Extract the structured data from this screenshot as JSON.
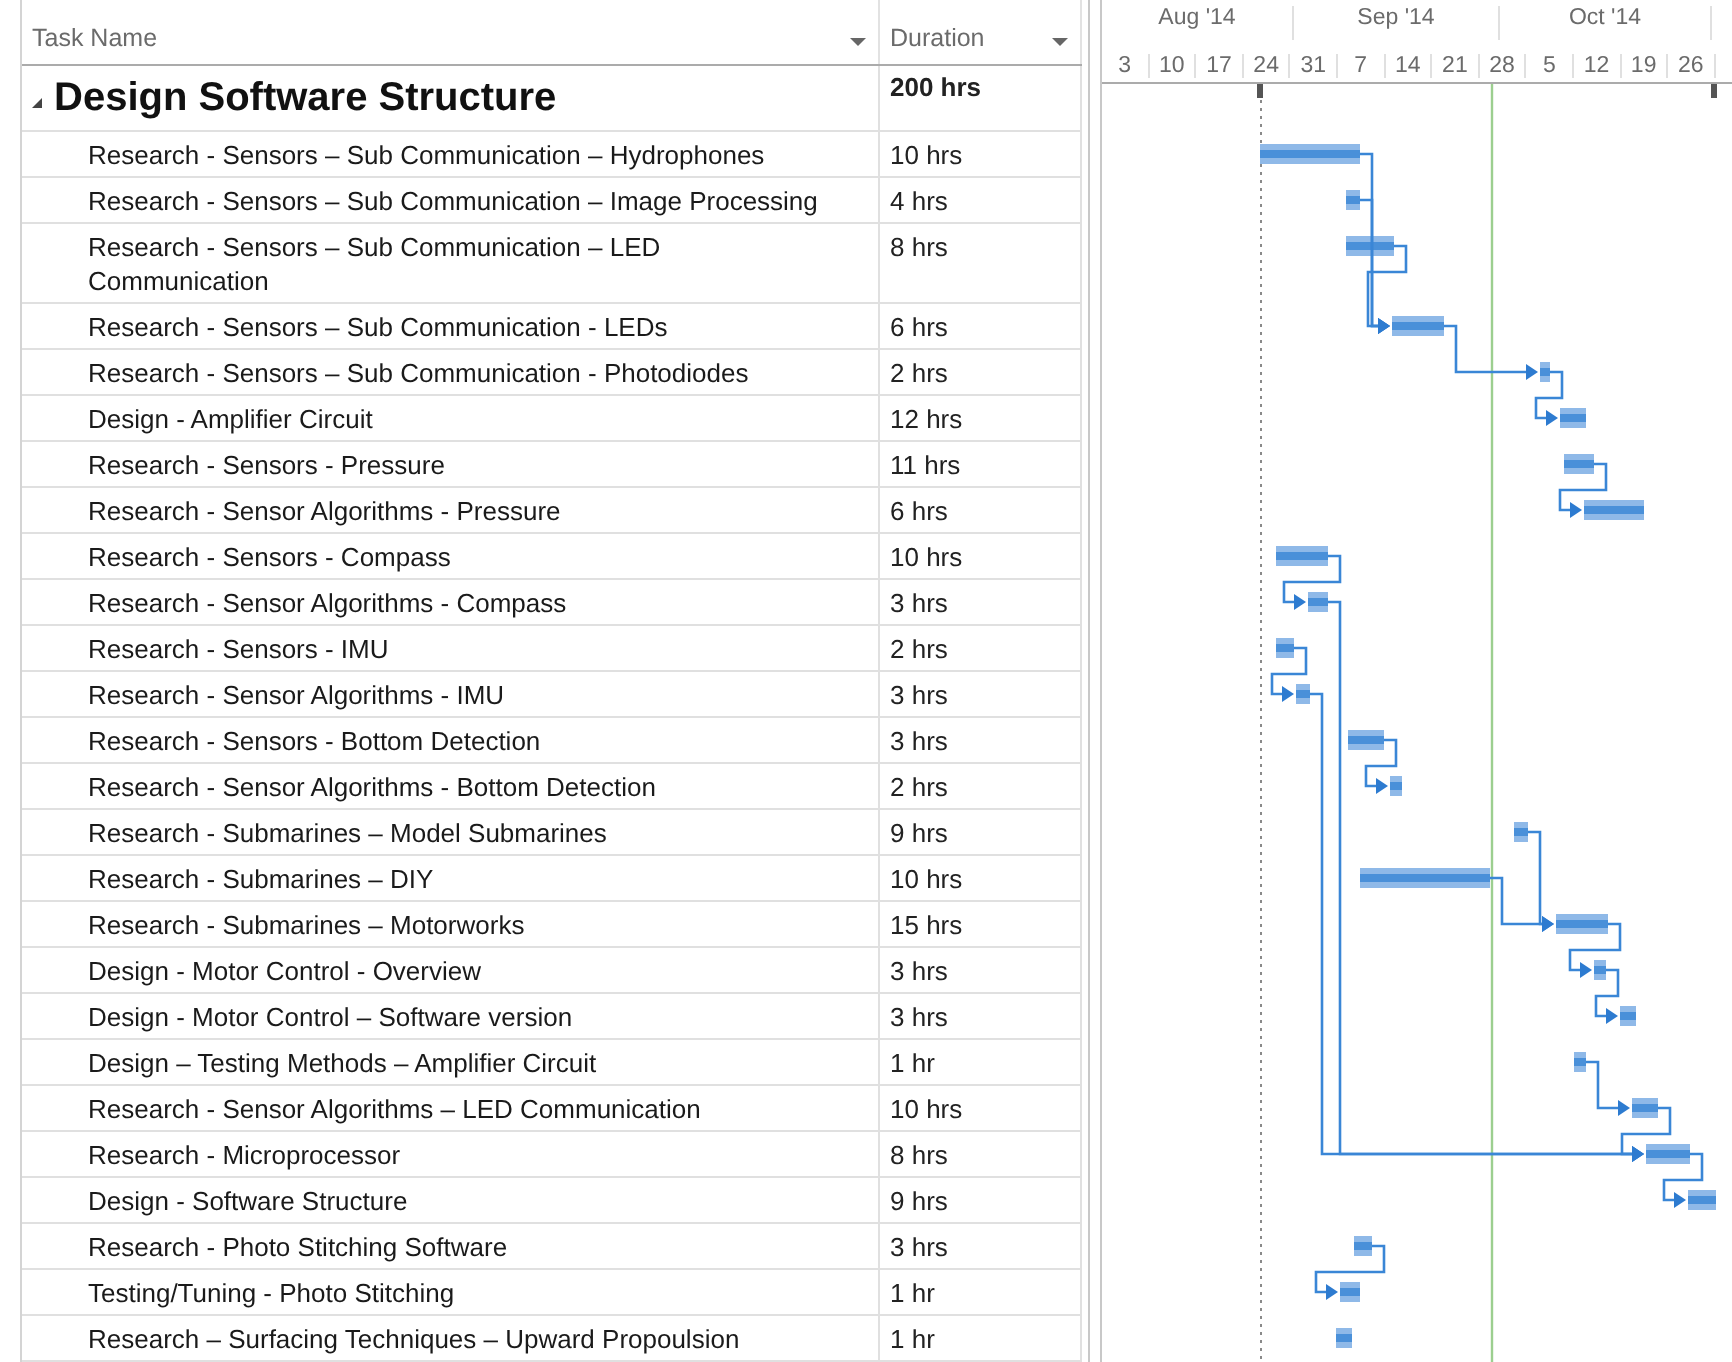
{
  "columns": [
    {
      "label": "Task Name"
    },
    {
      "label": "Duration"
    }
  ],
  "timescale": {
    "months": [
      {
        "label": "Aug '14"
      },
      {
        "label": "Sep '14"
      },
      {
        "label": "Oct '14"
      }
    ],
    "weeks": [
      "3",
      "10",
      "17",
      "24",
      "31",
      "7",
      "14",
      "21",
      "28",
      "5",
      "12",
      "19",
      "26"
    ]
  },
  "summary": {
    "name": "Design Software Structure",
    "duration": "200 hrs",
    "expanded": true
  },
  "tasks": [
    {
      "name": "Research - Sensors – Sub Communication – Hydrophones",
      "duration": "10 hrs"
    },
    {
      "name": "Research - Sensors – Sub Communication – Image Processing",
      "duration": "4 hrs"
    },
    {
      "name": "Research - Sensors – Sub Communication – LED Communication",
      "duration": "8 hrs"
    },
    {
      "name": "Research - Sensors – Sub Communication - LEDs",
      "duration": "6 hrs"
    },
    {
      "name": "Research - Sensors – Sub Communication - Photodiodes",
      "duration": "2 hrs"
    },
    {
      "name": "Design - Amplifier Circuit",
      "duration": "12 hrs"
    },
    {
      "name": "Research - Sensors - Pressure",
      "duration": "11 hrs"
    },
    {
      "name": "Research - Sensor Algorithms - Pressure",
      "duration": "6 hrs"
    },
    {
      "name": "Research - Sensors - Compass",
      "duration": "10 hrs"
    },
    {
      "name": "Research - Sensor Algorithms - Compass",
      "duration": "3 hrs"
    },
    {
      "name": "Research - Sensors - IMU",
      "duration": "2 hrs"
    },
    {
      "name": "Research - Sensor Algorithms - IMU",
      "duration": "3 hrs"
    },
    {
      "name": "Research - Sensors - Bottom Detection",
      "duration": "3 hrs"
    },
    {
      "name": "Research - Sensor Algorithms - Bottom Detection",
      "duration": "2 hrs"
    },
    {
      "name": "Research - Submarines – Model Submarines",
      "duration": "9 hrs"
    },
    {
      "name": "Research - Submarines – DIY",
      "duration": "10 hrs"
    },
    {
      "name": "Research - Submarines – Motorworks",
      "duration": "15 hrs"
    },
    {
      "name": "Design - Motor Control - Overview",
      "duration": "3 hrs"
    },
    {
      "name": "Design - Motor Control – Software version",
      "duration": "3 hrs"
    },
    {
      "name": "Design – Testing Methods – Amplifier Circuit",
      "duration": "1 hr"
    },
    {
      "name": "Research - Sensor Algorithms – LED Communication",
      "duration": "10 hrs"
    },
    {
      "name": "Research - Microprocessor",
      "duration": "8 hrs"
    },
    {
      "name": "Design - Software Structure",
      "duration": "9 hrs"
    },
    {
      "name": "Research - Photo Stitching Software",
      "duration": "3 hrs"
    },
    {
      "name": "Testing/Tuning - Photo Stitching",
      "duration": "1 hr"
    },
    {
      "name": "Research – Surfacing Techniques – Upward Propoulsion",
      "duration": "1 hr"
    }
  ]
}
